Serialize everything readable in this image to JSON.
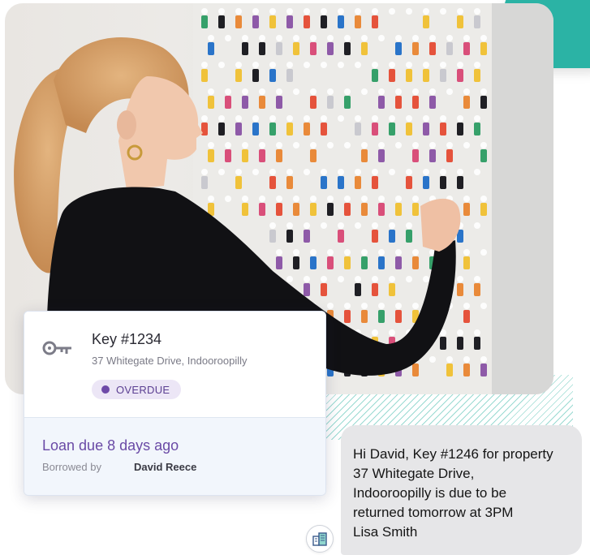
{
  "photo": {
    "subject": "woman-selecting-key-from-key-board"
  },
  "key_card": {
    "icon": "key-icon",
    "title": "Key #1234",
    "address": "37 Whitegate Drive, Indooroopilly",
    "status": "OVERDUE",
    "loan_due": "Loan due 8 days ago",
    "borrowed_label": "Borrowed by",
    "borrower_name": "David Reece",
    "colors": {
      "accent": "#6a4aa6",
      "badge_bg": "#ece6f6"
    }
  },
  "message": {
    "text": "Hi David, Key #1246 for property\n37 Whitegate Drive,\nIndooroopilly is due to be\nreturned tomorrow at 3PM\nLisa Smith",
    "avatar_icon": "building-icon"
  },
  "colors": {
    "teal": "#2bb3a5",
    "bubble_bg": "#e6e6e8"
  }
}
